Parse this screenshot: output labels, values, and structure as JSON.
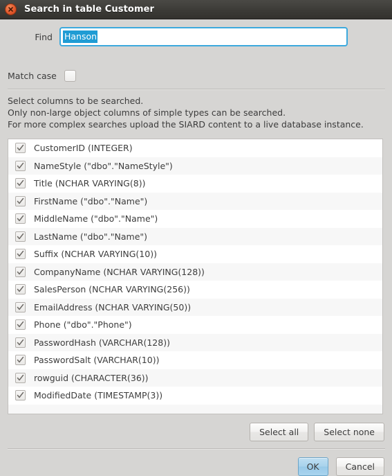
{
  "window": {
    "title": "Search in table Customer",
    "close_icon": "close-icon"
  },
  "find": {
    "label": "Find",
    "value": "Hanson",
    "placeholder": ""
  },
  "match_case": {
    "label": "Match case",
    "checked": false
  },
  "instructions": [
    "Select columns to be searched.",
    "Only non-large object columns of simple types can be searched.",
    "For more complex searches upload the SIARD content to a live database instance."
  ],
  "columns": [
    {
      "label": "CustomerID (INTEGER)",
      "checked": true
    },
    {
      "label": "NameStyle (\"dbo\".\"NameStyle\")",
      "checked": true
    },
    {
      "label": "Title (NCHAR VARYING(8))",
      "checked": true
    },
    {
      "label": "FirstName (\"dbo\".\"Name\")",
      "checked": true
    },
    {
      "label": "MiddleName (\"dbo\".\"Name\")",
      "checked": true
    },
    {
      "label": "LastName (\"dbo\".\"Name\")",
      "checked": true
    },
    {
      "label": "Suffix (NCHAR VARYING(10))",
      "checked": true
    },
    {
      "label": "CompanyName (NCHAR VARYING(128))",
      "checked": true
    },
    {
      "label": "SalesPerson (NCHAR VARYING(256))",
      "checked": true
    },
    {
      "label": "EmailAddress (NCHAR VARYING(50))",
      "checked": true
    },
    {
      "label": "Phone (\"dbo\".\"Phone\")",
      "checked": true
    },
    {
      "label": "PasswordHash (VARCHAR(128))",
      "checked": true
    },
    {
      "label": "PasswordSalt (VARCHAR(10))",
      "checked": true
    },
    {
      "label": "rowguid (CHARACTER(36))",
      "checked": true
    },
    {
      "label": "ModifiedDate (TIMESTAMP(3))",
      "checked": true
    }
  ],
  "buttons": {
    "select_all": "Select all",
    "select_none": "Select none",
    "ok": "OK",
    "cancel": "Cancel"
  },
  "colors": {
    "titlebar_bg": "#3c3b37",
    "dialog_bg": "#d6d5d3",
    "accent_focus": "#3ca9dd",
    "selection_bg": "#1f9cd4",
    "default_button_bg": "#a7d2ec",
    "close_button_bg": "#e2592c"
  }
}
